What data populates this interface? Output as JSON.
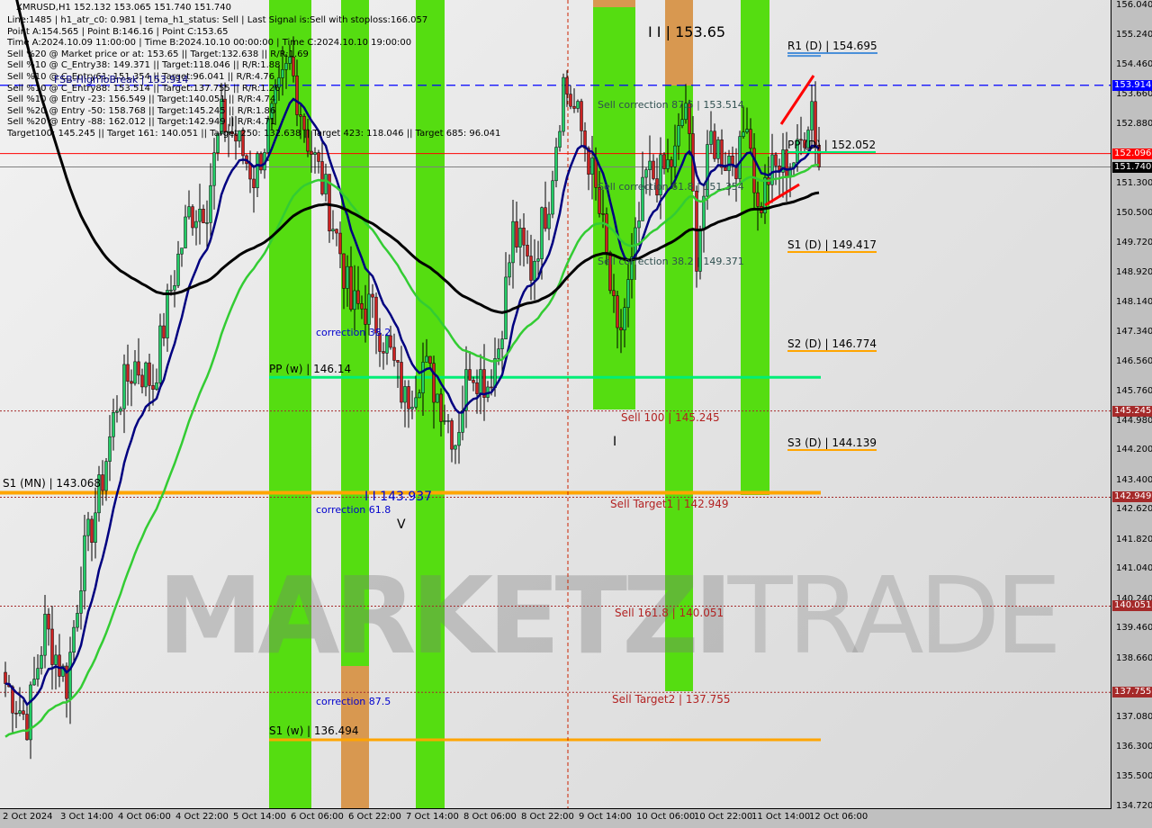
{
  "header": {
    "title": "XMRUSD,H1  152.132 153.065 151.740 151.740",
    "lines": [
      "Line:1485 | h1_atr_c0: 0.981 | tema_h1_status: Sell | Last Signal is:Sell with stoploss:166.057",
      "Point A:154.565 | Point B:146.16 | Point C:153.65",
      "Time A:2024.10.09 11:00:00 | Time B:2024.10.10 00:00:00 | Time C:2024.10.10 19:00:00",
      "Sell %20 @ Market price or at: 153.65 || Target:132.638 || R/R:1.69",
      "Sell %10 @ C_Entry38: 149.371 || Target:118.046 || R/R:1.88",
      "Sell %10 @ C_Entry61: 151.354 || Target:96.041 || R/R:4.76",
      "Sell %10 @ C_Entry88: 153.514 || Target:137.755 || R/R:1.26",
      "Sell %10 @ Entry -23: 156.549 || Target:140.051 || R/R:4.74",
      "Sell %20 @ Entry -50: 158.768 || Target:145.245 || R/R:1.86",
      "Sell %20 @ Entry -88: 162.012 || Target:142.949 || R/R:4.71",
      "Target100: 145.245 || Target 161: 140.051 || Target 250: 132.638 || Target 423: 118.046 || Target 685: 96.041"
    ]
  },
  "watermark": {
    "bold": "MARKETZI",
    "light": "TRADE"
  },
  "labels": {
    "fsb": "FSB-HighToBreak | 153.914",
    "c153": "I I | 153.65",
    "r1": "R1 (D) | 154.695",
    "pp_d": "PP (D) | 152.052",
    "s1_d": "S1 (D) | 149.417",
    "s2_d": "S2 (D) | 146.774",
    "s3_d": "S3 (D) | 144.139",
    "sc875": "Sell correction 87.5 | 153.514",
    "sc618": "Sell correction 61.8 | 151.354",
    "sc382": "Sell correction 38.2 | 149.371",
    "pp_w": "PP (w) | 146.14",
    "s1_w": "S1 (w) | 136.494",
    "s1_mn": "S1 (MN) | 143.068",
    "sell100": "Sell 100 | 145.245",
    "st1": "Sell Target1 | 142.949",
    "s1618": "Sell 161.8 | 140.051",
    "st2": "Sell Target2 | 137.755",
    "c382": "correction 38.2",
    "c618": "correction 61.8",
    "c875": "correction 87.5",
    "b143": "I I 143.937",
    "v": "V",
    "i": "I"
  },
  "chart_data": {
    "type": "candlestick",
    "symbol": "XMRUSD",
    "timeframe": "H1",
    "ylim": [
      134.72,
      156.04
    ],
    "y_ticks": [
      "156.040",
      "155.240",
      "154.460",
      "153.660",
      "152.880",
      "151.300",
      "150.500",
      "149.720",
      "148.920",
      "148.140",
      "147.340",
      "146.560",
      "145.760",
      "144.980",
      "144.200",
      "143.400",
      "142.620",
      "141.820",
      "141.040",
      "140.240",
      "139.460",
      "138.660",
      "137.080",
      "136.300",
      "135.500",
      "134.720"
    ],
    "price_tags": [
      {
        "value": "153.914",
        "color": "#0000ff"
      },
      {
        "value": "152.096",
        "color": "#ff0000"
      },
      {
        "value": "151.740",
        "color": "#000000"
      },
      {
        "value": "145.245",
        "color": "#a52a2a"
      },
      {
        "value": "142.949",
        "color": "#a52a2a"
      },
      {
        "value": "140.051",
        "color": "#a52a2a"
      },
      {
        "value": "137.755",
        "color": "#a52a2a"
      }
    ],
    "x_ticks": [
      "2 Oct 2024",
      "3 Oct 14:00",
      "4 Oct 06:00",
      "4 Oct 22:00",
      "5 Oct 14:00",
      "6 Oct 06:00",
      "6 Oct 22:00",
      "7 Oct 14:00",
      "8 Oct 06:00",
      "8 Oct 22:00",
      "9 Oct 14:00",
      "10 Oct 06:00",
      "10 Oct 22:00",
      "11 Oct 14:00",
      "12 Oct 06:00"
    ],
    "levels": [
      {
        "name": "FSB-HighToBreak",
        "value": 153.914,
        "color": "#0000ff",
        "style": "dashed"
      },
      {
        "name": "bid",
        "value": 152.096,
        "color": "#ff0000",
        "style": "solid"
      },
      {
        "name": "last",
        "value": 151.74,
        "color": "#808080",
        "style": "solid"
      },
      {
        "name": "PP (w)",
        "value": 146.14,
        "color": "#00ee77",
        "style": "thick"
      },
      {
        "name": "S1 (MN)",
        "value": 143.068,
        "color": "#ffa500",
        "style": "thick"
      },
      {
        "name": "S1 (w)",
        "value": 136.494,
        "color": "#ffa500",
        "style": "thick"
      },
      {
        "name": "Sell 100",
        "value": 145.245,
        "color": "#a52a2a",
        "style": "dotted"
      },
      {
        "name": "Sell Target1",
        "value": 142.949,
        "color": "#a52a2a",
        "style": "dotted"
      },
      {
        "name": "Sell 161.8",
        "value": 140.051,
        "color": "#a52a2a",
        "style": "dotted"
      },
      {
        "name": "Sell Target2",
        "value": 137.755,
        "color": "#a52a2a",
        "style": "dotted"
      }
    ],
    "colors": {
      "bull": "#22cc66",
      "bear": "#cc2222",
      "fast_ma": "#000080",
      "mid_ma": "#33cc33",
      "slow_ma": "#000000",
      "band_green": "#55dd11",
      "band_orange": "#d89850"
    },
    "price_path": [
      [
        "2024-10-02T22:00",
        138.0
      ],
      [
        "2024-10-03T04:00",
        137.0
      ],
      [
        "2024-10-03T09:00",
        139.5
      ],
      [
        "2024-10-03T15:00",
        138.0
      ],
      [
        "2024-10-03T19:00",
        141.0
      ],
      [
        "2024-10-04T00:00",
        143.0
      ],
      [
        "2024-10-04T05:00",
        145.5
      ],
      [
        "2024-10-04T10:00",
        146.5
      ],
      [
        "2024-10-04T15:00",
        146.0
      ],
      [
        "2024-10-04T20:00",
        148.5
      ],
      [
        "2024-10-05T01:00",
        150.5
      ],
      [
        "2024-10-05T06:00",
        150.8
      ],
      [
        "2024-10-05T10:00",
        153.0
      ],
      [
        "2024-10-05T14:00",
        152.5
      ],
      [
        "2024-10-05T19:00",
        151.5
      ],
      [
        "2024-10-06T00:00",
        153.0
      ],
      [
        "2024-10-06T05:00",
        154.5
      ],
      [
        "2024-10-06T10:00",
        152.5
      ],
      [
        "2024-10-06T15:00",
        151.0
      ],
      [
        "2024-10-06T19:00",
        149.5
      ],
      [
        "2024-10-06T22:00",
        148.0
      ],
      [
        "2024-10-07T03:00",
        148.0
      ],
      [
        "2024-10-07T08:00",
        147.0
      ],
      [
        "2024-10-07T13:00",
        145.5
      ],
      [
        "2024-10-07T18:00",
        146.5
      ],
      [
        "2024-10-07T23:00",
        145.5
      ],
      [
        "2024-10-08T03:00",
        144.5
      ],
      [
        "2024-10-08T07:00",
        146.5
      ],
      [
        "2024-10-08T12:00",
        146.0
      ],
      [
        "2024-10-08T15:00",
        147.0
      ],
      [
        "2024-10-08T19:00",
        150.0
      ],
      [
        "2024-10-09T00:00",
        149.0
      ],
      [
        "2024-10-09T05:00",
        151.0
      ],
      [
        "2024-10-09T09:00",
        154.0
      ],
      [
        "2024-10-09T13:00",
        153.0
      ],
      [
        "2024-10-09T16:00",
        152.0
      ],
      [
        "2024-10-09T20:00",
        150.0
      ],
      [
        "2024-10-10T00:00",
        147.0
      ],
      [
        "2024-10-10T04:00",
        149.0
      ],
      [
        "2024-10-10T08:00",
        151.5
      ],
      [
        "2024-10-10T12:00",
        151.5
      ],
      [
        "2024-10-10T16:00",
        152.0
      ],
      [
        "2024-10-10T19:00",
        153.5
      ],
      [
        "2024-10-10T22:00",
        149.5
      ],
      [
        "2024-10-11T02:00",
        152.5
      ],
      [
        "2024-10-11T06:00",
        152.0
      ],
      [
        "2024-10-11T10:00",
        152.0
      ],
      [
        "2024-10-11T12:00",
        153.3
      ],
      [
        "2024-10-11T15:00",
        150.5
      ],
      [
        "2024-10-11T18:00",
        151.5
      ],
      [
        "2024-10-11T22:00",
        151.8
      ],
      [
        "2024-10-12T02:00",
        152.0
      ],
      [
        "2024-10-12T06:00",
        153.5
      ],
      [
        "2024-10-12T08:00",
        151.74
      ]
    ]
  }
}
